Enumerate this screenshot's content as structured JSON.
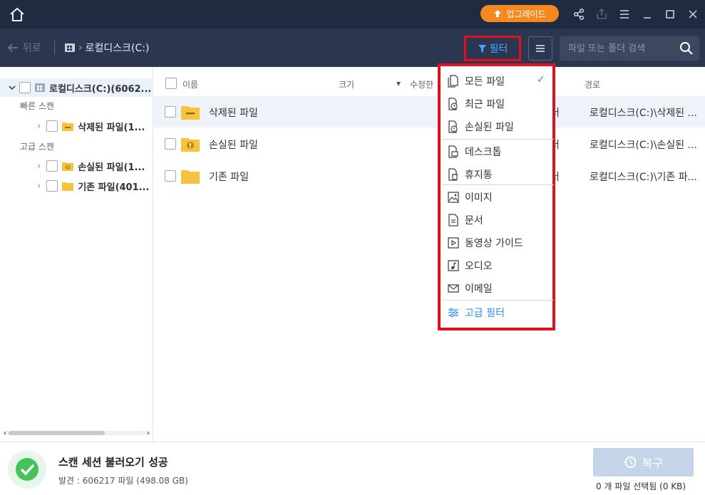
{
  "topbar": {
    "upgrade_label": "업그레이드",
    "accent": "#f5891f"
  },
  "nav": {
    "back_label": "뒤로",
    "breadcrumb": "로컬디스크(C:)",
    "filter_label": "필터",
    "search_placeholder": "파일 또는 폴더 검색"
  },
  "sidebar": {
    "root_label": "로컬디스크(C:)(6062...",
    "section_quick": "빠른 스캔",
    "section_advanced": "고급 스캔",
    "items": [
      {
        "label": "삭제된 파일(1..."
      },
      {
        "label": "손실된 파일(1..."
      },
      {
        "label": "기존 파일(401..."
      }
    ]
  },
  "table": {
    "headers": {
      "name": "이름",
      "size": "크기",
      "modified": "수정한",
      "path": "경로"
    },
    "rows": [
      {
        "name": "삭제된 파일",
        "kind": "터",
        "path": "로컬디스크(C:)\\삭제된 ..."
      },
      {
        "name": "손실된 파일",
        "kind": "터",
        "path": "로컬디스크(C:)\\손실된 ..."
      },
      {
        "name": "기존 파일",
        "kind": "터",
        "path": "로컬디스크(C:)\\기존 파..."
      }
    ]
  },
  "filter_menu": {
    "selected_mark": "✓",
    "items": [
      {
        "label": "모든 파일",
        "icon": "all-files-icon"
      },
      {
        "label": "최근 파일",
        "icon": "recent-files-icon"
      },
      {
        "label": "손실된 파일",
        "icon": "lost-files-icon"
      },
      {
        "label": "데스크톱",
        "icon": "desktop-icon"
      },
      {
        "label": "휴지통",
        "icon": "trash-icon"
      },
      {
        "label": "이미지",
        "icon": "image-icon"
      },
      {
        "label": "문서",
        "icon": "document-icon"
      },
      {
        "label": "동영상 가이드",
        "icon": "video-icon"
      },
      {
        "label": "오디오",
        "icon": "audio-icon"
      },
      {
        "label": "이메일",
        "icon": "email-icon"
      },
      {
        "label": "고급 필터",
        "icon": "advanced-filter-icon"
      }
    ]
  },
  "footer": {
    "title": "스캔 세션 불러오기 성공",
    "subtitle": "발견 : 606217 파일 (498.08 GB)",
    "recover_label": "복구",
    "selection_info": "0 개 파일 선택됨 (0 KB)"
  }
}
